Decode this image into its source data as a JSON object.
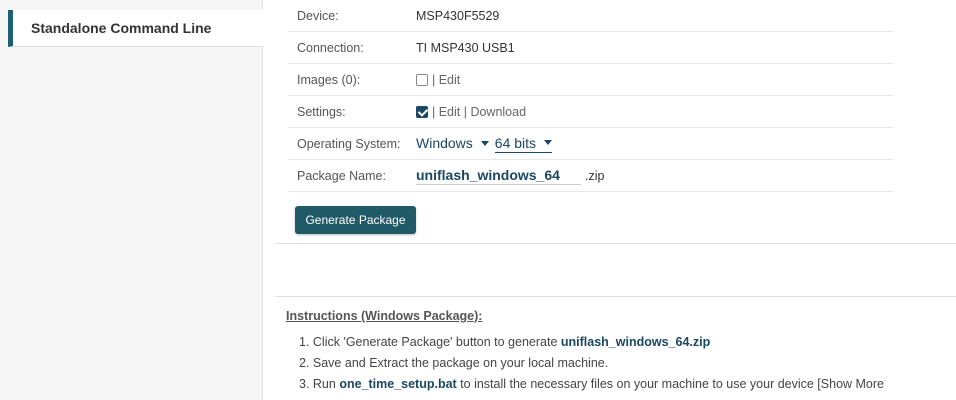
{
  "sidebar": {
    "items": [
      {
        "label": "Standalone Command Line"
      }
    ]
  },
  "form": {
    "device": {
      "label": "Device:",
      "value": "MSP430F5529"
    },
    "connection": {
      "label": "Connection:",
      "value": "TI MSP430 USB1"
    },
    "images": {
      "label": "Images (0):",
      "checked": false,
      "links": "| Edit"
    },
    "settings": {
      "label": "Settings:",
      "checked": true,
      "links": "| Edit | Download"
    },
    "os": {
      "label": "Operating System:",
      "os_value": "Windows",
      "bits_value": "64 bits"
    },
    "package": {
      "label": "Package Name:",
      "value": "uniflash_windows_64",
      "suffix": ".zip"
    }
  },
  "buttons": {
    "generate_label": "Generate Package"
  },
  "instructions": {
    "title": "Instructions (Windows Package):",
    "step1_prefix": "1. Click 'Generate Package' button to generate ",
    "step1_file": "uniflash_windows_64.zip",
    "step2": "2. Save and Extract the package on your local machine.",
    "step3_prefix": "3. Run ",
    "step3_file": "one_time_setup.bat",
    "step3_suffix": " to install the necessary files on your machine to use your device [Show More"
  },
  "colors": {
    "accent": "#1a4862",
    "button": "#1f5a66",
    "sidebar_indicator": "#1f5f73"
  }
}
